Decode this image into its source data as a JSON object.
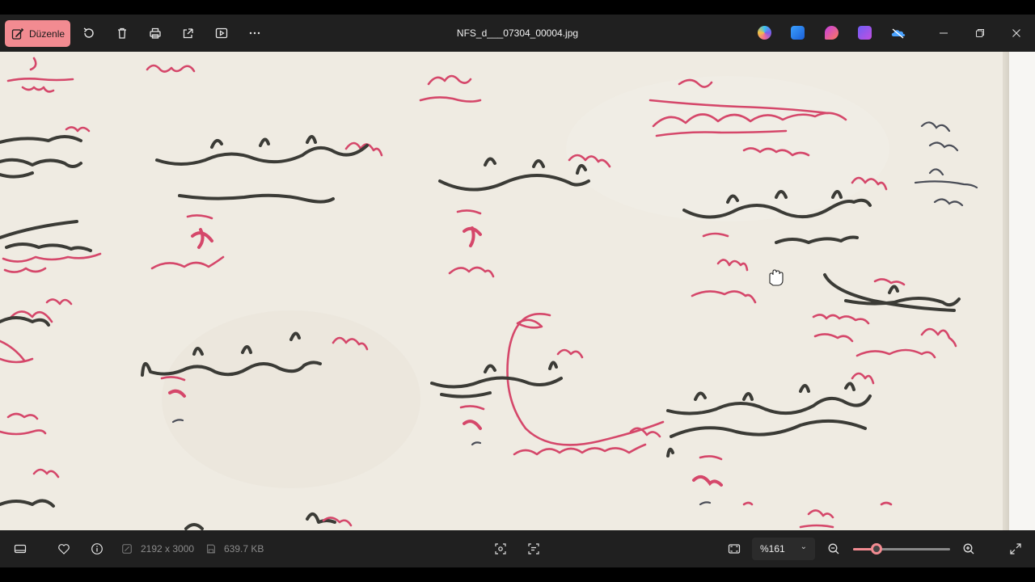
{
  "titlebar": {
    "edit_label": "Düzenle",
    "filename": "NFS_d___07304_00004.jpg",
    "icons": [
      "rotate-icon",
      "delete-icon",
      "print-icon",
      "share-icon",
      "slideshow-icon",
      "more-icon"
    ],
    "app_icons": [
      "copilot-icon",
      "designer-icon",
      "clipchamp-icon",
      "photos-icon",
      "onedrive-icon"
    ],
    "window_controls": [
      "minimize-icon",
      "restore-icon",
      "close-icon"
    ]
  },
  "statusbar": {
    "dimensions": "2192 x 3000",
    "file_size": "639.7 KB",
    "zoom_value": "%161",
    "zoom_slider_fraction": 0.24
  },
  "colors": {
    "accent": "#f28b91",
    "chrome": "#202020",
    "paper": "#ede9e0",
    "red_ink": "#d5476a",
    "black_ink": "#3b3b36"
  },
  "viewer": {
    "cursor": "hand-cursor-icon"
  }
}
